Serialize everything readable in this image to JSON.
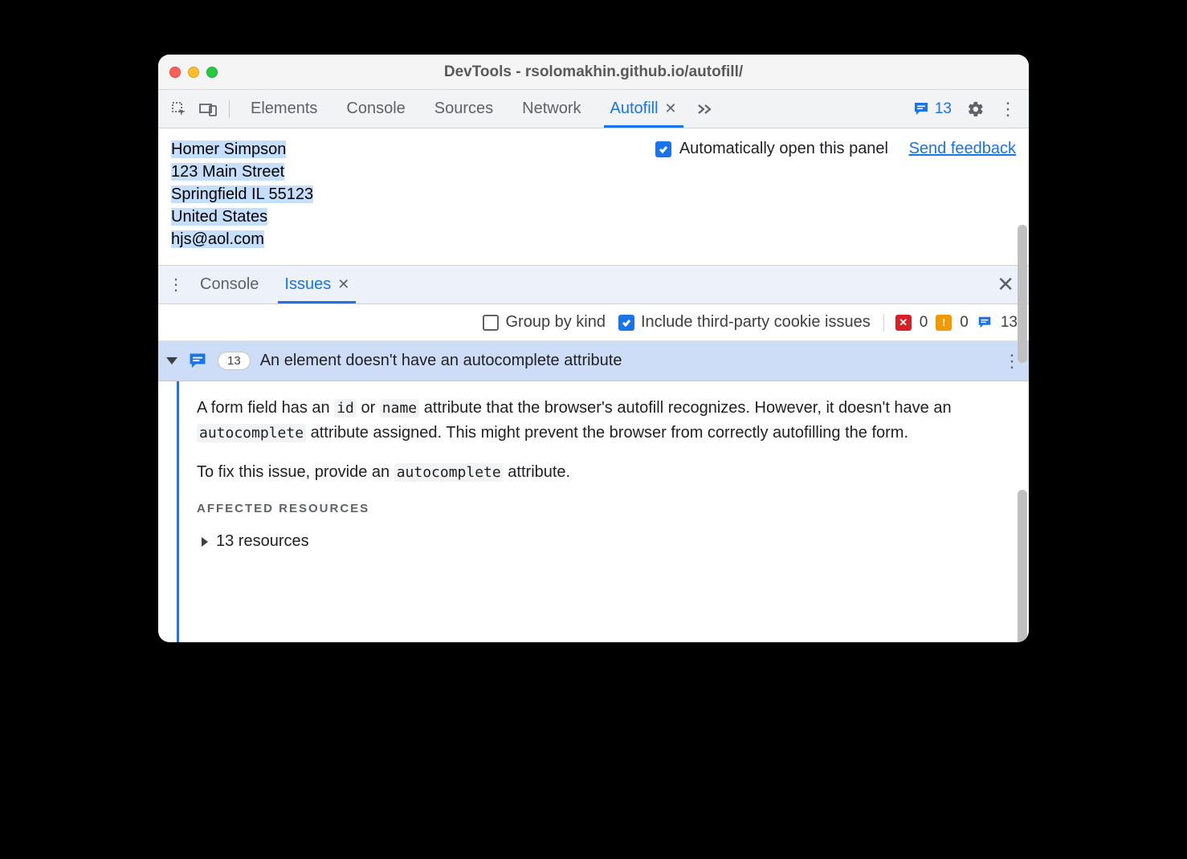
{
  "window": {
    "title": "DevTools - rsolomakhin.github.io/autofill/"
  },
  "toolbar": {
    "tabs": [
      "Elements",
      "Console",
      "Sources",
      "Network",
      "Autofill"
    ],
    "active_tab": "Autofill",
    "issue_count": "13"
  },
  "autofill_panel": {
    "address_lines": [
      "Homer Simpson",
      "123 Main Street",
      "Springfield IL 55123",
      "United States",
      "hjs@aol.com"
    ],
    "auto_open_label": "Automatically open this panel",
    "feedback_label": "Send feedback"
  },
  "drawer": {
    "tabs": [
      "Console",
      "Issues"
    ],
    "active_tab": "Issues"
  },
  "issues_filter": {
    "group_by_kind": "Group by kind",
    "include_3p": "Include third-party cookie issues",
    "counters": {
      "errors": "0",
      "warnings": "0",
      "info": "13"
    }
  },
  "issue": {
    "badge_count": "13",
    "title": "An element doesn't have an autocomplete attribute",
    "paragraph1_a": "A form field has an ",
    "code_id": "id",
    "paragraph1_b": " or ",
    "code_name": "name",
    "paragraph1_c": " attribute that the browser's autofill recognizes. However, it doesn't have an ",
    "code_autocomplete": "autocomplete",
    "paragraph1_d": " attribute assigned. This might prevent the browser from correctly autofilling the form.",
    "paragraph2_a": "To fix this issue, provide an ",
    "paragraph2_b": " attribute.",
    "affected_label": "AFFECTED RESOURCES",
    "resources_label": "13 resources"
  }
}
